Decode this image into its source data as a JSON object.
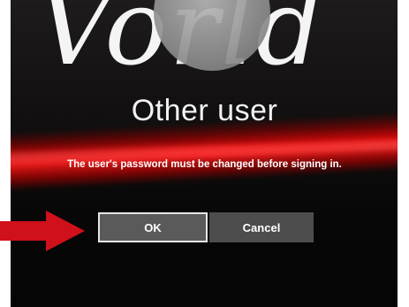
{
  "wallpaper": {
    "script_text": "Vorld"
  },
  "dialog": {
    "user_name": "Other user",
    "message": "The user's password must be changed before signing in.",
    "buttons": {
      "ok_label": "OK",
      "cancel_label": "Cancel"
    }
  },
  "annotation": {
    "arrow_color": "#d0101a"
  },
  "colors": {
    "streak_red": "#e31b1b",
    "button_gray": "#5a5a5a",
    "focus_border": "#e6e6e6"
  }
}
